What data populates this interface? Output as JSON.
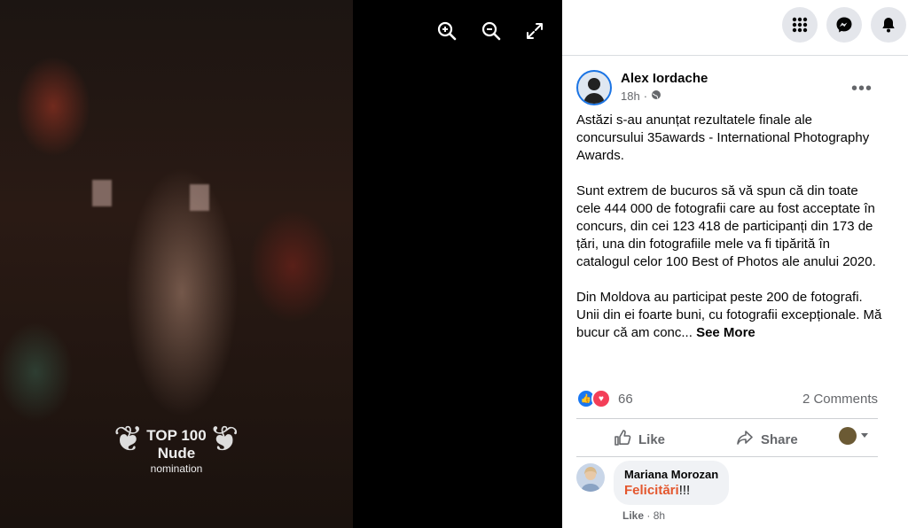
{
  "viewer": {
    "award": {
      "line1": "TOP 100",
      "line2": "Nude",
      "line3": "nomination"
    },
    "controls": [
      "zoom-in-icon",
      "zoom-out-icon",
      "fullscreen-icon"
    ]
  },
  "topbar": {
    "buttons": [
      "menu-grid-icon",
      "messenger-icon",
      "notifications-icon"
    ]
  },
  "post": {
    "author": "Alex Iordache",
    "time": "18h",
    "more": "•••",
    "paragraphs": [
      "Astăzi s-au anunțat rezultatele finale ale concursului 35awards - International Photography Awards.",
      "Sunt extrem de bucuros să vă spun că din toate cele 444 000 de fotografii care au fost acceptate în concurs, din cei 123 418 de participanți din 173 de țări, una din fotografiile mele va fi tipărită în catalogul celor 100 Best of Photos ale anului 2020.",
      "Din Moldova au participat peste 200 de fotografi. Unii din ei foarte buni, cu fotografii excepționale. Mă bucur că am conc..."
    ],
    "see_more": "See More",
    "reaction_count": "66",
    "comments_count": "2 Comments",
    "like_label": "Like",
    "share_label": "Share"
  },
  "comment": {
    "name": "Mariana Morozan",
    "word": "Felicitări",
    "suffix": "!!!",
    "like_label": "Like",
    "separator": " · ",
    "time": "8h"
  },
  "colors": {
    "accent": "#1b74e4",
    "like_blue": "#1877f2",
    "love_red": "#f33e58",
    "comment_word": "#e4572e"
  }
}
